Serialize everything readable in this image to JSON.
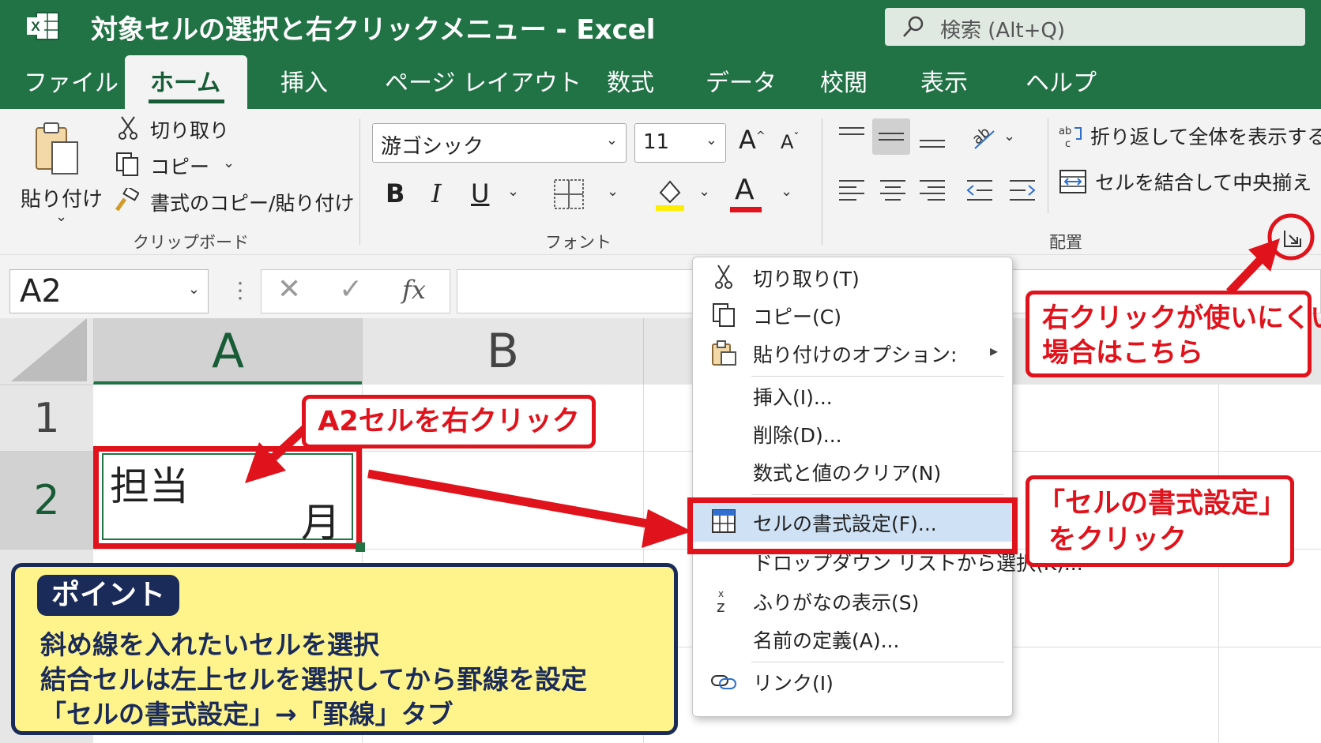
{
  "titlebar": {
    "title": "対象セルの選択と右クリックメニュー  -  Excel",
    "search_placeholder": "検索 (Alt+Q)"
  },
  "tabs": [
    {
      "label": "ファイル"
    },
    {
      "label": "ホーム"
    },
    {
      "label": "挿入"
    },
    {
      "label": "ページ レイアウト"
    },
    {
      "label": "数式"
    },
    {
      "label": "データ"
    },
    {
      "label": "校閲"
    },
    {
      "label": "表示"
    },
    {
      "label": "ヘルプ"
    }
  ],
  "ribbon": {
    "clipboard": {
      "paste": "貼り付け",
      "cut": "切り取り",
      "copy": "コピー",
      "format_painter": "書式のコピー/貼り付け",
      "group_label": "クリップボード"
    },
    "font": {
      "font_name": "游ゴシック",
      "font_size": "11",
      "bold": "B",
      "italic": "I",
      "underline": "U",
      "font_color_glyph": "A",
      "grow_glyph": "A",
      "shrink_glyph": "A",
      "group_label": "フォント",
      "highlight_color": "#ffee00",
      "font_color": "#e0121b"
    },
    "alignment": {
      "wrap_text": "折り返して全体を表示する",
      "merge_center": "セルを結合して中央揃え",
      "group_label": "配置"
    }
  },
  "formula_bar": {
    "name_box": "A2",
    "fx": "fx"
  },
  "grid": {
    "columns": [
      "A",
      "B"
    ],
    "rows": [
      "1",
      "2"
    ],
    "cell_a2_top": "担当",
    "cell_a2_bottom": "月"
  },
  "context_menu": {
    "items": [
      {
        "label": "切り取り(T)",
        "icon": "scissors-icon"
      },
      {
        "label": "コピー(C)",
        "icon": "copy-icon"
      },
      {
        "label": "貼り付けのオプション:",
        "icon": "clipboard-icon"
      },
      {
        "label": "挿入(I)...",
        "icon": ""
      },
      {
        "label": "削除(D)...",
        "icon": ""
      },
      {
        "label": "数式と値のクリア(N)",
        "icon": ""
      },
      {
        "label": "セルの書式設定(F)...",
        "icon": "format-cells-icon"
      },
      {
        "label": "ドロップダウン リストから選択(K)...",
        "icon": ""
      },
      {
        "label": "ふりがなの表示(S)",
        "icon": "furigana-icon"
      },
      {
        "label": "名前の定義(A)...",
        "icon": ""
      },
      {
        "label": "リンク(I)",
        "icon": "link-icon"
      }
    ]
  },
  "callouts": {
    "click_a2": "A2セルを右クリック",
    "right_click_hard": [
      "右クリックが使いにくい",
      "場合はこちら"
    ],
    "format_cells": [
      "「セルの書式設定」",
      "をクリック"
    ]
  },
  "point": {
    "title": "ポイント",
    "lines": [
      "斜め線を入れたいセルを選択",
      "結合セルは左上セルを選択してから罫線を設定",
      "「セルの書式設定」→「罫線」タブ"
    ]
  },
  "colors": {
    "excel_green": "#217346",
    "callout_red": "#e0121b",
    "point_bg": "#fff48c",
    "point_navy": "#1a2b5a",
    "menu_highlight": "#cfe2f5"
  }
}
